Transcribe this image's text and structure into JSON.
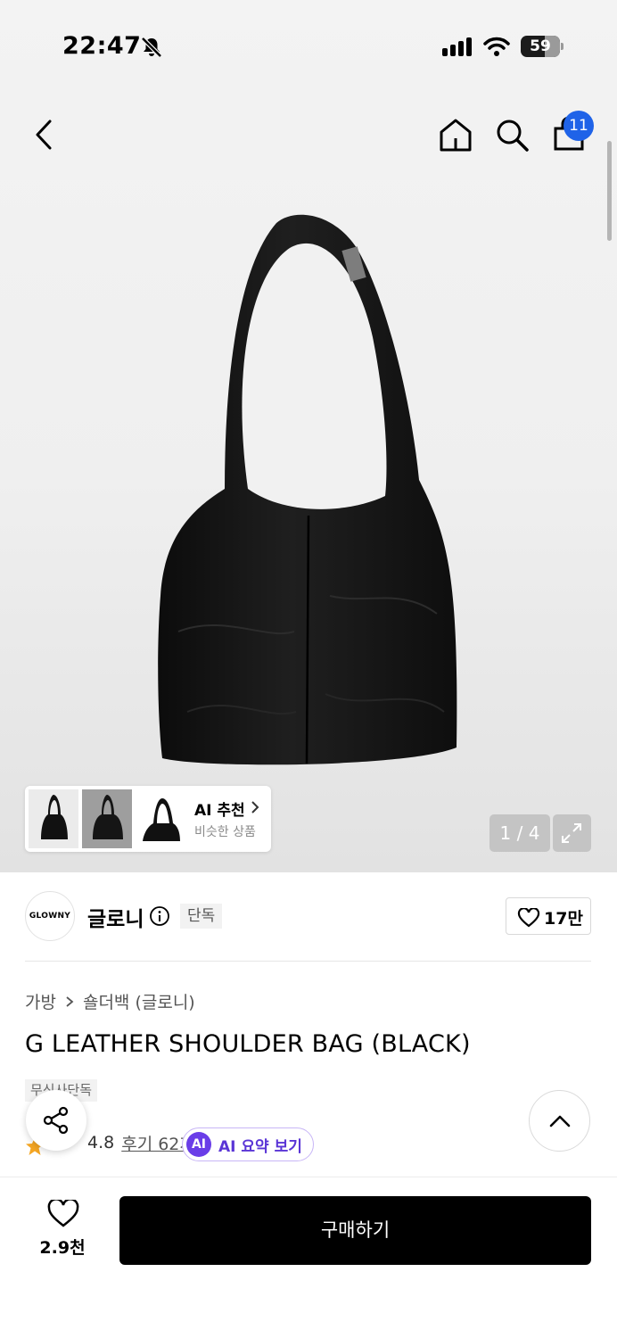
{
  "status_bar": {
    "time": "22:47",
    "battery": "59",
    "icons": [
      "bell-slash-icon",
      "signal-icon",
      "wifi-icon",
      "battery-icon"
    ]
  },
  "nav": {
    "icons": [
      "back-icon",
      "home-icon",
      "search-icon",
      "shopping-bag-icon"
    ],
    "cart_count": "11"
  },
  "gallery": {
    "page_indicator": "1 / 4",
    "ai_recommendation": {
      "title": "AI 추천",
      "subtitle": "비슷한 상품"
    }
  },
  "brand": {
    "logo_text": "GLOWNY",
    "name": "글로니",
    "badge": "단독",
    "like_count": "17만"
  },
  "product": {
    "breadcrumb": [
      "가방",
      "숄더백 (글로니)"
    ],
    "title": "G LEATHER SHOULDER BAG (BLACK)",
    "badge": "무신사단독",
    "rating": "4.8",
    "review_link": "후기 62개",
    "ai_summary_icon": "AI",
    "ai_summary_label": "AI 요약 보기"
  },
  "bottom": {
    "wish_count": "2.9천",
    "buy_label": "구매하기"
  },
  "colors": {
    "badge_blue": "#1f63e8",
    "ai_purple": "#6a3de8",
    "star_orange": "#f5a623",
    "buy_black": "#000000"
  }
}
